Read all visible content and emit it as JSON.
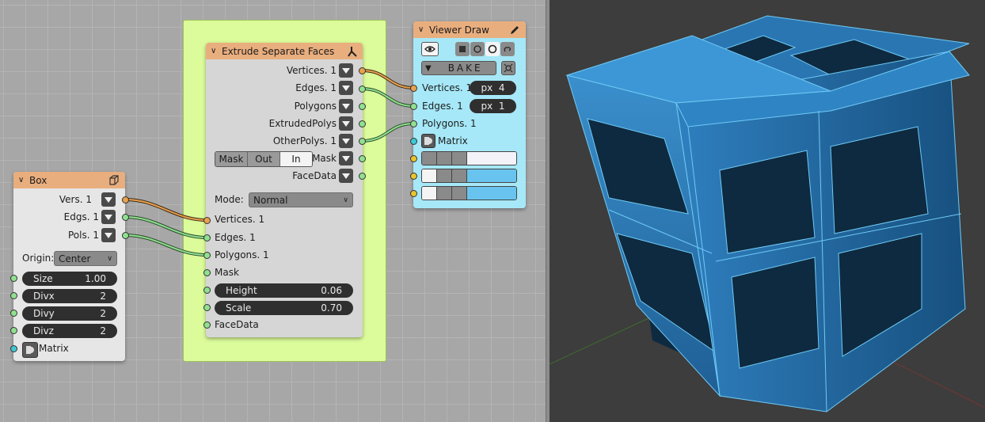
{
  "box_node": {
    "title": "Box",
    "outputs": [
      {
        "label": "Vers. 1"
      },
      {
        "label": "Edgs. 1"
      },
      {
        "label": "Pols. 1"
      }
    ],
    "origin_label": "Origin:",
    "origin_value": "Center",
    "fields": [
      {
        "label": "Size",
        "value": "1.00"
      },
      {
        "label": "Divx",
        "value": "2"
      },
      {
        "label": "Divy",
        "value": "2"
      },
      {
        "label": "Divz",
        "value": "2"
      }
    ],
    "matrix_label": "Matrix"
  },
  "extrude_node": {
    "title": "Extrude Separate Faces",
    "outputs": [
      {
        "label": "Vertices. 1"
      },
      {
        "label": "Edges. 1"
      },
      {
        "label": "Polygons"
      },
      {
        "label": "ExtrudedPolys"
      },
      {
        "label": "OtherPolys. 1"
      }
    ],
    "mask_modes": [
      "Mask",
      "Out",
      "In"
    ],
    "mask_mode_selected": "In",
    "mask_output_label": "Mask",
    "facedata_output_label": "FaceData",
    "mode_label": "Mode:",
    "mode_value": "Normal",
    "inputs": [
      {
        "label": "Vertices. 1"
      },
      {
        "label": "Edges. 1"
      },
      {
        "label": "Polygons. 1"
      },
      {
        "label": "Mask"
      }
    ],
    "fields": [
      {
        "label": "Height",
        "value": "0.06"
      },
      {
        "label": "Scale",
        "value": "0.70"
      }
    ],
    "facedata_input_label": "FaceData"
  },
  "viewer_node": {
    "title": "Viewer Draw",
    "bake_label": "BAKE",
    "inputs": [
      {
        "label": "Vertices. 1",
        "param": "px  4"
      },
      {
        "label": "Edges. 1",
        "param": "px  1"
      },
      {
        "label": "Polygons. 1"
      },
      {
        "label": "Matrix"
      }
    ],
    "color_swatches": [
      "#f2f2f8",
      "#68c4ee",
      "#68c4ee"
    ]
  },
  "colors": {
    "node_header": "#e9ae7e",
    "frame": "#dcfb9a",
    "viewer_body": "#a6e8f8",
    "vertex_wire": "#e8a14d",
    "edge_wire": "#8fe08f",
    "mesh": "#2d7fbf"
  },
  "icons": {
    "box_header": "cube-icon",
    "extrude_header": "extrude-icon",
    "viewer_header": "pencil-icon"
  }
}
